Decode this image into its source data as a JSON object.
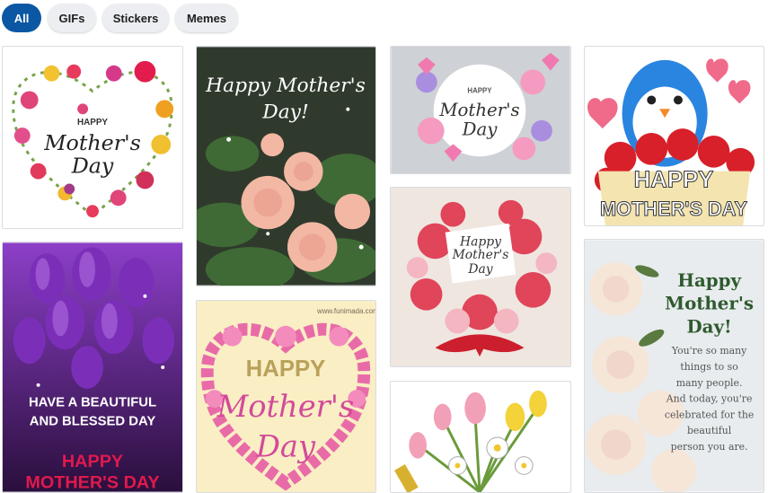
{
  "filters": [
    {
      "label": "All",
      "active": true
    },
    {
      "label": "GIFs",
      "active": false
    },
    {
      "label": "Stickers",
      "active": false
    },
    {
      "label": "Memes",
      "active": false
    }
  ],
  "cards": {
    "c1": {
      "line1": "HAPPY",
      "line2": "Mother's",
      "line3": "Day"
    },
    "c2": {
      "line1": "Happy Mother's",
      "line2": "Day!"
    },
    "c3": {
      "line1": "HAPPY",
      "line2": "Mother's",
      "line3": "Day"
    },
    "c4": {
      "line1": "HAPPY",
      "line2": "MOTHER'S DAY"
    },
    "c5": {
      "line1": "HAVE A BEAUTIFUL",
      "line2": "AND BLESSED DAY",
      "line3": "HAPPY",
      "line4": "MOTHER'S DAY"
    },
    "c6": {
      "watermark": "www.funimada.com",
      "line1": "HAPPY",
      "line2": "Mother's",
      "line3": "Day"
    },
    "c7": {
      "line1": "Happy",
      "line2": "Mother's",
      "line3": "Day"
    },
    "c8": {},
    "c9": {
      "line1": "Happy",
      "line2": "Mother's",
      "line3": "Day!",
      "msg1": "You're so many",
      "msg2": "things to so",
      "msg3": "many people.",
      "msg4": "And today, you're",
      "msg5": "celebrated for the",
      "msg6": "beautiful",
      "msg7": "person you are."
    }
  }
}
